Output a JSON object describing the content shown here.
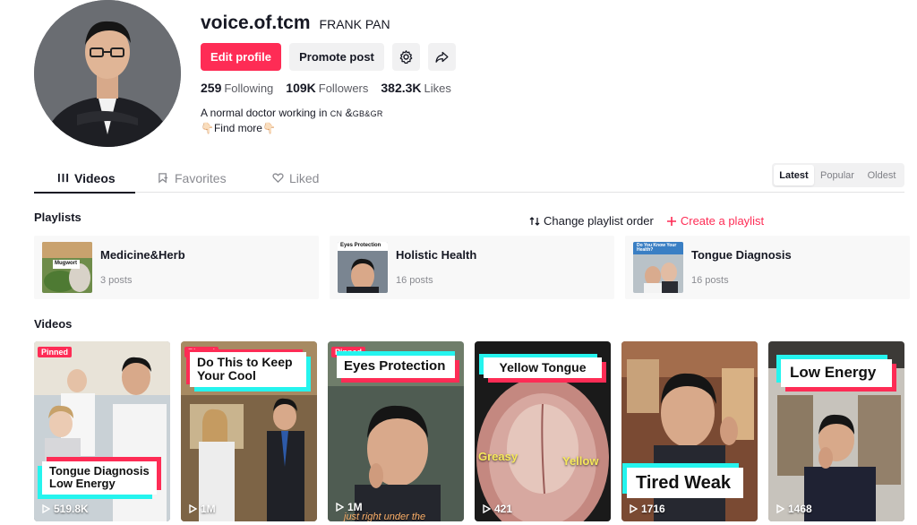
{
  "profile": {
    "username": "voice.of.tcm",
    "nickname": "FRANK PAN",
    "edit_label": "Edit profile",
    "promote_label": "Promote post",
    "stats": [
      {
        "value": "259",
        "label": "Following"
      },
      {
        "value": "109K",
        "label": "Followers"
      },
      {
        "value": "382.3K",
        "label": "Likes"
      }
    ],
    "bio_line1_prefix": "A normal doctor working in ",
    "bio_line1_cn": "CN",
    "bio_line1_mid": " &",
    "bio_line1_rest": "GB&GR",
    "bio_line2": "Find more",
    "bio_emoji": "👇🏻"
  },
  "tabs": [
    {
      "label": "Videos",
      "icon": "grid-icon",
      "active": true
    },
    {
      "label": "Favorites",
      "icon": "bookmark-icon",
      "active": false
    },
    {
      "label": "Liked",
      "icon": "heart-icon",
      "active": false
    }
  ],
  "sort": [
    "Latest",
    "Popular",
    "Oldest"
  ],
  "sort_selected": "Latest",
  "playlists_section": {
    "title": "Playlists",
    "change_order": "Change playlist order",
    "create": "Create a playlist",
    "items": [
      {
        "name": "Medicine&Herb",
        "count": "3 posts",
        "thumb_text": "Mugwort"
      },
      {
        "name": "Holistic Health",
        "count": "16 posts",
        "thumb_text": "Eyes Protection"
      },
      {
        "name": "Tongue Diagnosis",
        "count": "16 posts",
        "thumb_text": "Do You Know Your Health?"
      }
    ]
  },
  "videos_section": {
    "title": "Videos",
    "pinned_label": "Pinned",
    "items": [
      {
        "caption": "Tongue Diagnosis Low Energy",
        "views": "519.8K",
        "pinned": true
      },
      {
        "caption": "Do This to Keep Your Cool",
        "views": "1M",
        "pinned": true
      },
      {
        "caption": "Eyes Protection",
        "views": "1M",
        "pinned": true,
        "subtitle": "just right under the"
      },
      {
        "caption": "Yellow Tongue",
        "views": "421",
        "pinned": false,
        "overlay1": "Greasy",
        "overlay2": "Yellow"
      },
      {
        "caption": "Tired Weak",
        "views": "1716",
        "pinned": false
      },
      {
        "caption": "Low Energy",
        "views": "1468",
        "pinned": false
      }
    ]
  },
  "colors": {
    "accent": "#fe2c55",
    "cyan": "#25f4ee",
    "text": "#161823",
    "muted": "#8a8b91"
  }
}
